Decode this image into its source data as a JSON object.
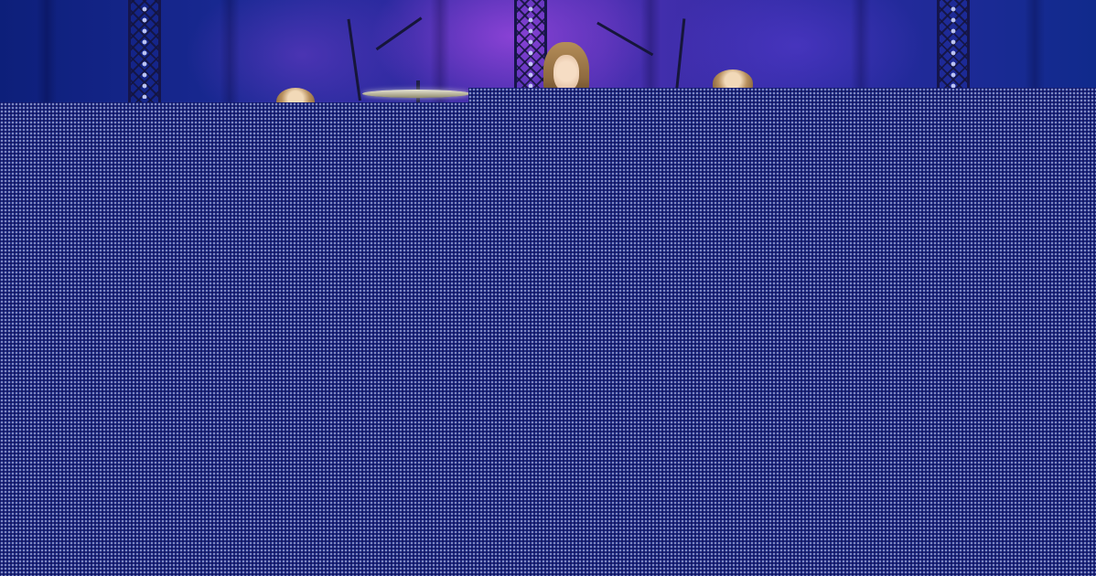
{
  "scene": {
    "subject": "band-on-stage",
    "colors": {
      "stage_blue": "#1b2a96",
      "stage_purple": "#4a2fb0",
      "pattern_base": "#1f2a82",
      "pattern_dot": "#e1e6ff"
    }
  }
}
